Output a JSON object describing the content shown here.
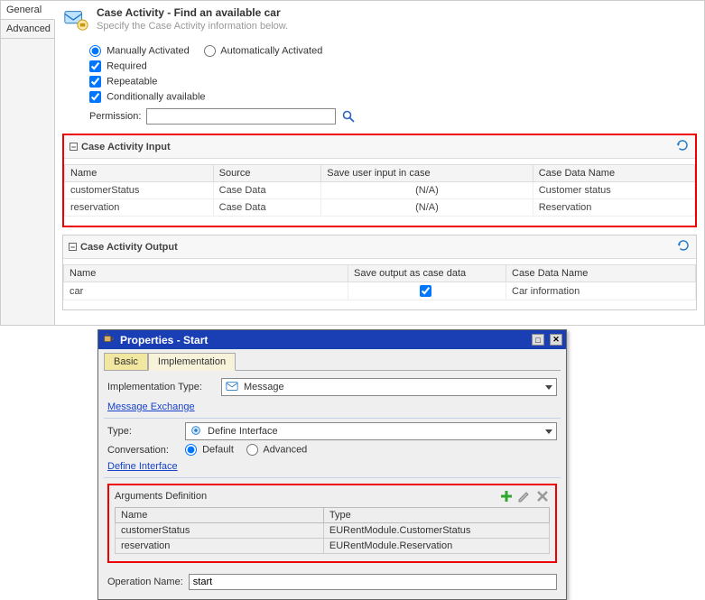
{
  "tabs": {
    "general": "General",
    "advanced": "Advanced"
  },
  "header": {
    "title": "Case Activity - Find an available car",
    "subtitle": "Specify the Case Activity information below."
  },
  "activation": {
    "manual": "Manually Activated",
    "auto": "Automatically Activated"
  },
  "flags": {
    "required": "Required",
    "repeatable": "Repeatable",
    "conditional": "Conditionally available"
  },
  "permission": {
    "label": "Permission:",
    "value": ""
  },
  "input_section": {
    "title": "Case Activity Input",
    "columns": {
      "name": "Name",
      "source": "Source",
      "save": "Save user input in case",
      "case_data": "Case Data Name"
    },
    "rows": [
      {
        "name": "customerStatus",
        "source": "Case Data",
        "save": "(N/A)",
        "case_data": "Customer status"
      },
      {
        "name": "reservation",
        "source": "Case Data",
        "save": "(N/A)",
        "case_data": "Reservation"
      }
    ]
  },
  "output_section": {
    "title": "Case Activity Output",
    "columns": {
      "name": "Name",
      "save": "Save output as case data",
      "case_data": "Case Data Name"
    },
    "rows": [
      {
        "name": "car",
        "save_checked": true,
        "case_data": "Car information"
      }
    ]
  },
  "dialog": {
    "title": "Properties - Start",
    "tabs": {
      "basic": "Basic",
      "impl": "Implementation"
    },
    "impl_type": {
      "label": "Implementation Type:",
      "value": "Message"
    },
    "msg_exchange_label": "Message Exchange",
    "type": {
      "label": "Type:",
      "value": "Define Interface"
    },
    "conversation": {
      "label": "Conversation:",
      "default": "Default",
      "advanced": "Advanced"
    },
    "define_interface_label": "Define Interface",
    "args": {
      "title": "Arguments Definition",
      "columns": {
        "name": "Name",
        "type": "Type"
      },
      "rows": [
        {
          "name": "customerStatus",
          "type": "EURentModule.CustomerStatus"
        },
        {
          "name": "reservation",
          "type": "EURentModule.Reservation"
        }
      ]
    },
    "operation": {
      "label": "Operation Name:",
      "value": "start"
    }
  }
}
